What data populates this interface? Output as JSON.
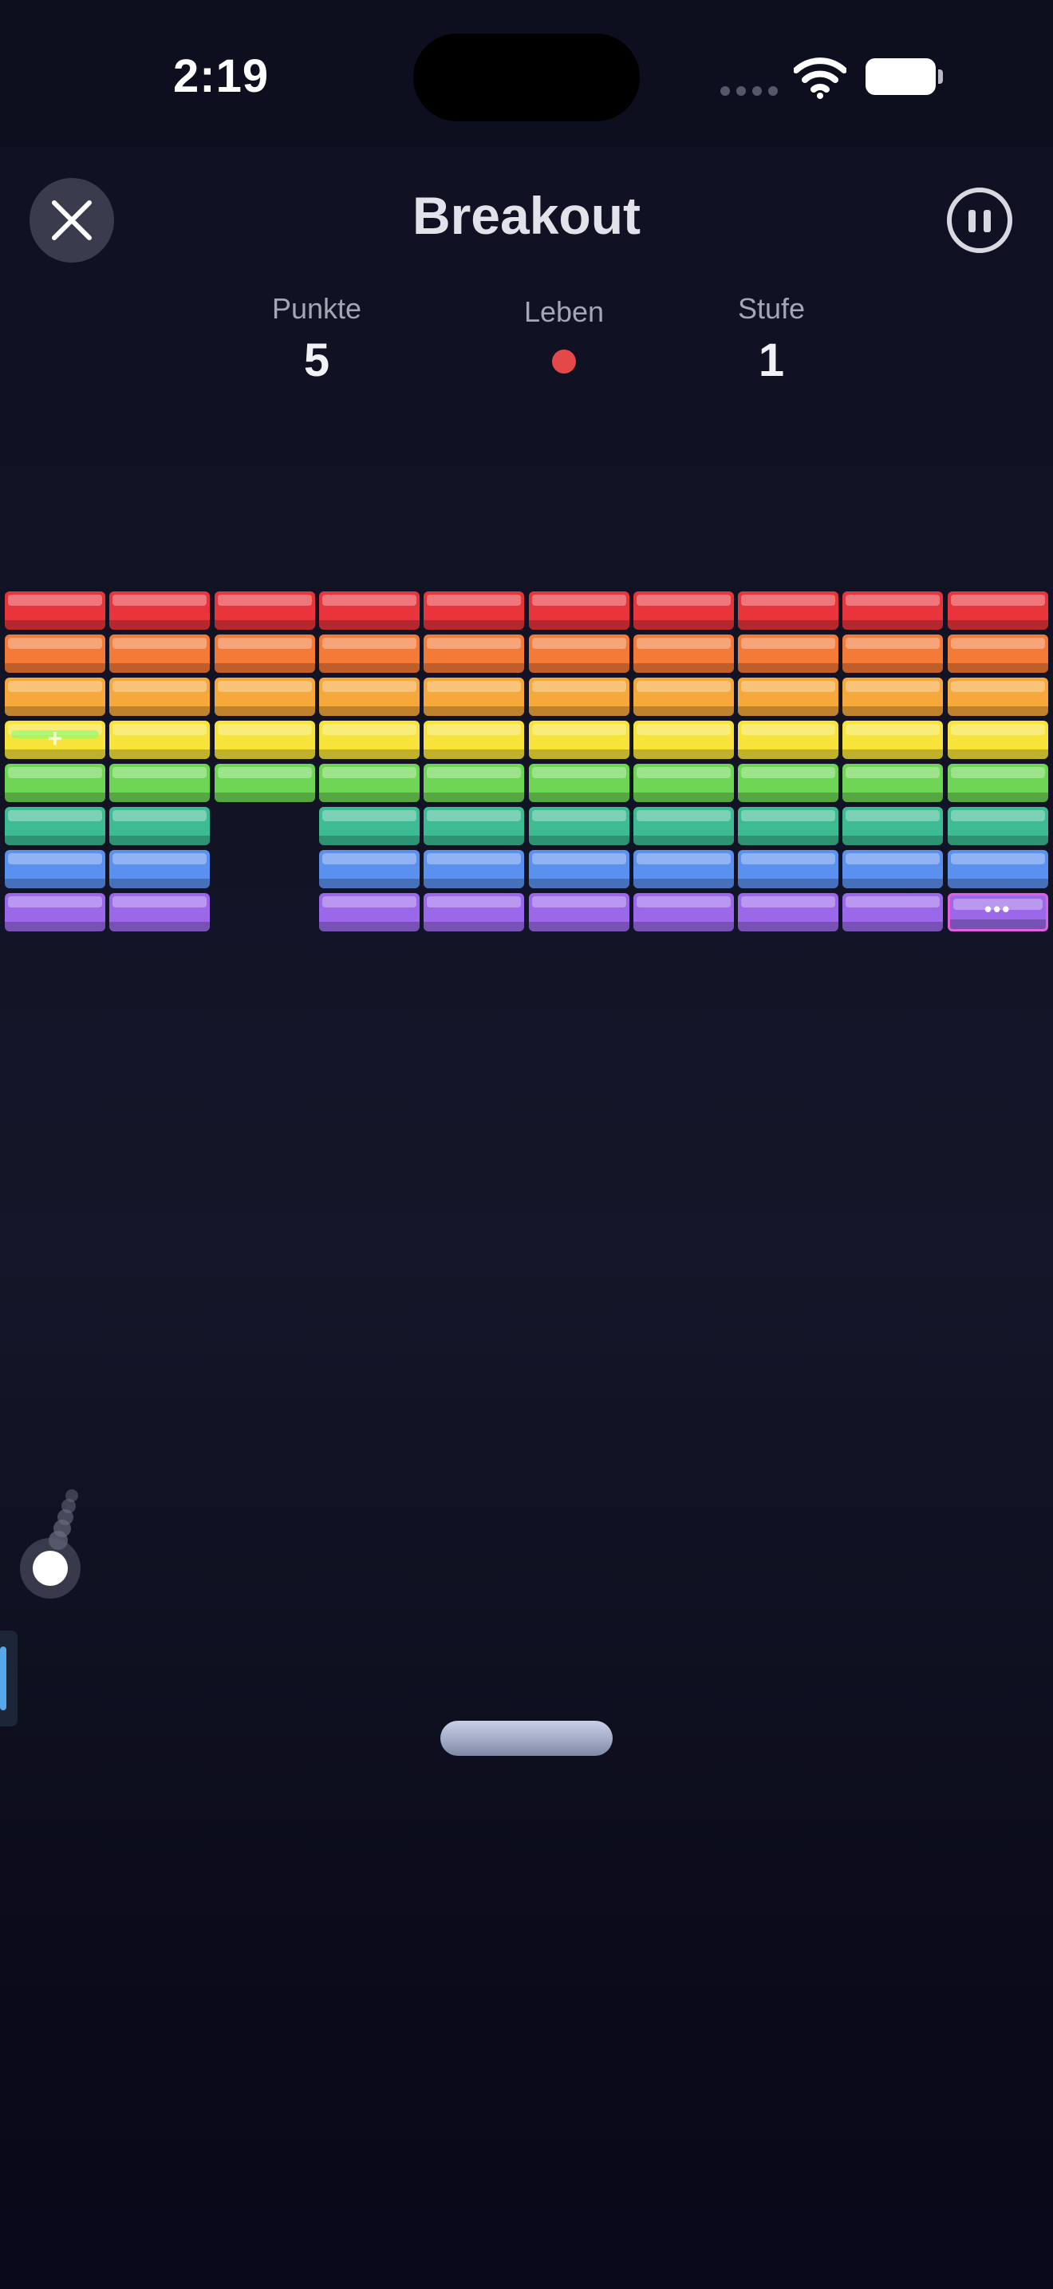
{
  "status_bar": {
    "time": "2:19"
  },
  "header": {
    "title": "Breakout",
    "close_icon": "close-icon",
    "pause_icon": "pause-icon"
  },
  "stats": {
    "score_label": "Punkte",
    "score_value": "5",
    "lives_label": "Leben",
    "lives_count": 1,
    "level_label": "Stufe",
    "level_value": "1"
  },
  "colors": {
    "background": "#121426",
    "life": "#e54848",
    "rows": [
      "#e8353b",
      "#f47a38",
      "#f7a83a",
      "#f7e33a",
      "#6fd655",
      "#3dbb92",
      "#5a90ee",
      "#9a68e8"
    ],
    "powerup_border": "#e060e0"
  },
  "bricks": {
    "columns": 10,
    "rows": 8,
    "layout": [
      "1111111111",
      "1111111111",
      "1111111111",
      "1111111111",
      "1111111111",
      "1101111111",
      "1101111111",
      "1101111111"
    ],
    "powerups": [
      {
        "row": 3,
        "col": 0,
        "mark": "+"
      },
      {
        "row": 7,
        "col": 9,
        "mark": "•••"
      }
    ]
  }
}
